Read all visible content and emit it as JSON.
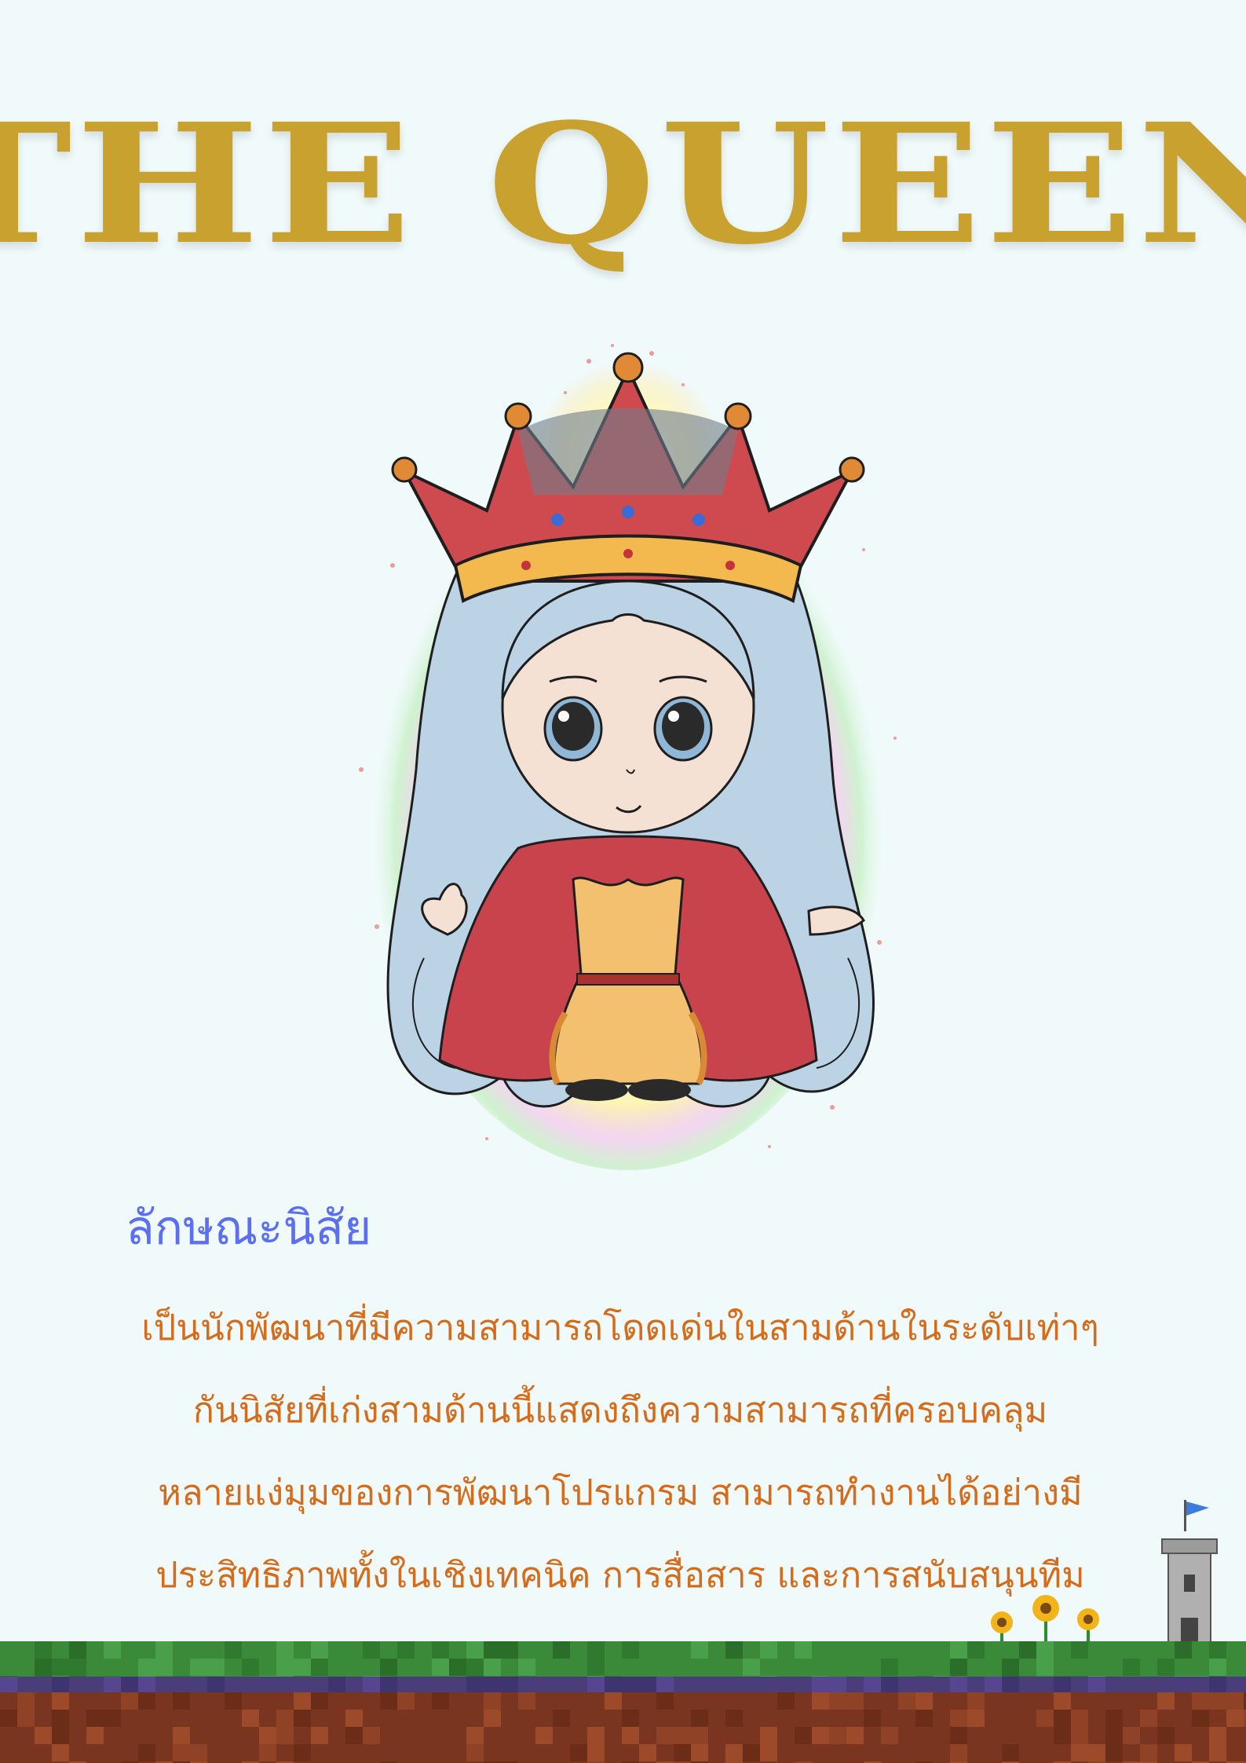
{
  "title": "THE QUEEN",
  "section": {
    "heading": "ลักษณะนิสัย",
    "lines": [
      "เป็นนักพัฒนาที่มีความสามารถโดดเด่นในสามด้านในระดับเท่าๆ",
      "กันนิสัยที่เก่งสามด้านนี้แสดงถึงความสามารถที่ครอบคลุม",
      "หลายแง่มุมของการพัฒนาโปรแกรม สามารถทำงานได้อย่างมี",
      "ประสิทธิภาพทั้งในเชิงเทคนิค การสื่อสาร และการสนับสนุนทีม"
    ]
  },
  "colors": {
    "background": "#f0fafb",
    "title": "#c9a12e",
    "heading": "#5b6ff0",
    "body_text": "#d56c1c",
    "grass": "#3a8a3a",
    "dirt": "#7a3520",
    "crown": "#cf4a4f",
    "cape": "#c8434c",
    "dress": "#f2c06e",
    "hair": "#bcd3e6",
    "skin": "#f4e1d4"
  },
  "illustration": {
    "subject": "chibi-queen-with-crown",
    "icons": [
      "crown-icon",
      "sunflower-icon",
      "castle-tower-icon",
      "flag-icon"
    ]
  }
}
